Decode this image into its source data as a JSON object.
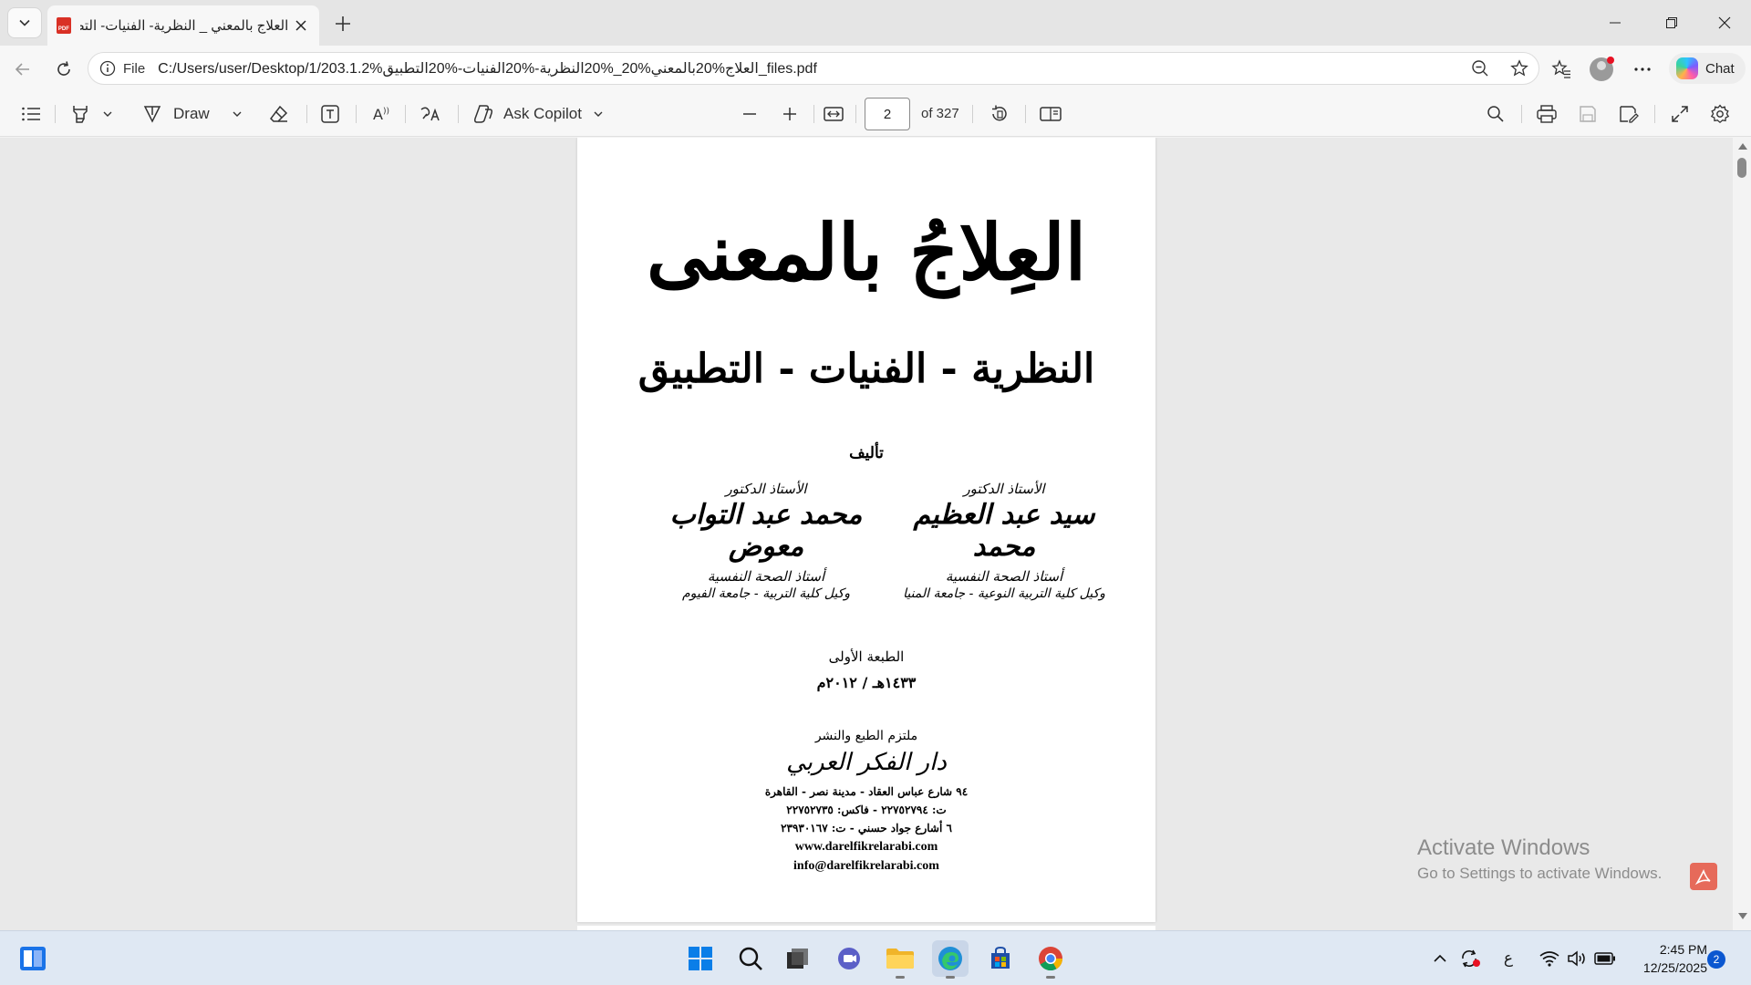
{
  "tab": {
    "title": "العلاج بالمعني _ النظرية- الفنيات- التطبيق",
    "favicon_label": "PDF"
  },
  "address": {
    "scheme_label": "File",
    "url": "C:/Users/user/Desktop/1/203.1.2%العلاج%20بالمعني%20_%20النظرية-%20الفنيات-%20التطبيق_files.pdf"
  },
  "chat": {
    "label": "Chat"
  },
  "pdf_toolbar": {
    "draw_label": "Draw",
    "copilot_label": "Ask Copilot",
    "page_current": "2",
    "page_total_label": "of 327"
  },
  "document": {
    "title": "العِلاجُ بالمعنى",
    "subtitle": "النظرية - الفنيات - التطبيق",
    "authorship_label": "تأليف",
    "authors": [
      {
        "title": "الأستاذ الدكتور",
        "name": "سيد عبد العظيم محمد",
        "role": "أستاذ الصحة النفسية",
        "affiliation": "وكيل كلية التربية النوعية - جامعة المنيا"
      },
      {
        "title": "الأستاذ الدكتور",
        "name": "محمد عبد التواب معوض",
        "role": "أستاذ الصحة النفسية",
        "affiliation": "وكيل كلية التربية - جامعة الفيوم"
      }
    ],
    "edition": "الطبعة الأولى",
    "edition_date": "١٤٣٣هـ / ٢٠١٢م",
    "publisher_label": "ملتزم الطبع والنشر",
    "publisher_name": "دار الفكر العربي",
    "publisher_address": "٩٤ شارع عباس العقاد - مدينة نصر - القاهرة",
    "publisher_phone": "ت: ٢٢٧٥٢٧٩٤ - فاكس: ٢٢٧٥٢٧٣٥",
    "publisher_branch": "٦ أشارع جواد حسني - ت: ٢٣٩٣٠١٦٧",
    "website": "www.darelfikrelarabi.com",
    "email": "info@darelfikrelarabi.com"
  },
  "watermark": {
    "title": "Activate Windows",
    "subtitle": "Go to Settings to activate Windows."
  },
  "taskbar": {
    "ime_label": "ع",
    "time": "2:45 PM",
    "date": "12/25/2025",
    "notification_count": "2"
  }
}
